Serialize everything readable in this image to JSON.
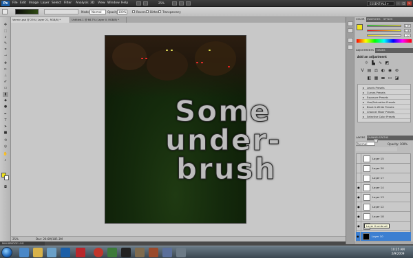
{
  "menubar": {
    "app_logo": "Ps",
    "items": [
      "File",
      "Edit",
      "Image",
      "Layer",
      "Select",
      "Filter",
      "Analysis",
      "3D",
      "View",
      "Window",
      "Help"
    ],
    "zoom": "25%",
    "workspace": "ESSENTIALS ▾"
  },
  "options": {
    "mode_label": "Mode:",
    "mode_value": "Normal",
    "opacity_label": "Opacity:",
    "opacity_value": "100%",
    "reverse_label": "Reverse",
    "dither_label": "Dither",
    "transparency_label": "Transparency"
  },
  "tabs": [
    {
      "label": "Vermin.psd @ 25% (Layer 21, RGB/8) *"
    },
    {
      "label": "Untitled-1 @ 66.7% (Layer 0, RGB/8) *"
    }
  ],
  "canvas": {
    "handwritten_text": [
      "Some",
      "under-",
      "brush"
    ]
  },
  "status": {
    "zoom": "25%",
    "doc": "Doc: 20.6M/185.3M",
    "minibridge": "MINI BRIDGE  LOG"
  },
  "color_panel": {
    "tabs": [
      "COLOR",
      "SWATCHES",
      "STYLES"
    ],
    "r": "239",
    "g": "228",
    "b": "27"
  },
  "adjustments_panel": {
    "tabs": [
      "ADJUSTMENTS",
      "MASKS"
    ],
    "heading": "Add an adjustment",
    "presets": [
      "Levels Presets",
      "Curves Presets",
      "Exposure Presets",
      "Hue/Saturation Presets",
      "Black & White Presets",
      "Channel Mixer Presets",
      "Selective Color Presets"
    ]
  },
  "layers_panel": {
    "tabs": [
      "LAYERS",
      "CHANNELS",
      "PATHS"
    ],
    "blend": "Normal",
    "opacity": "Opacity: 100%",
    "layers": [
      {
        "name": "Layer 15"
      },
      {
        "name": "Layer 20"
      },
      {
        "name": "Layer 17"
      },
      {
        "name": "Layer 14"
      },
      {
        "name": "Layer 13"
      },
      {
        "name": "Layer 12"
      },
      {
        "name": "Layer 18"
      },
      {
        "name": "Layer 9"
      },
      {
        "name": "Layer 7"
      },
      {
        "name": "Layer 10"
      }
    ],
    "tooltip": "Layer thumbnail"
  },
  "taskbar": {
    "time": "10:25 AM",
    "date": "2/9/2009"
  },
  "colors": {
    "foreground": "#f1e41b",
    "background": "#ffffff",
    "selected_layer": "#3c7fd1"
  }
}
